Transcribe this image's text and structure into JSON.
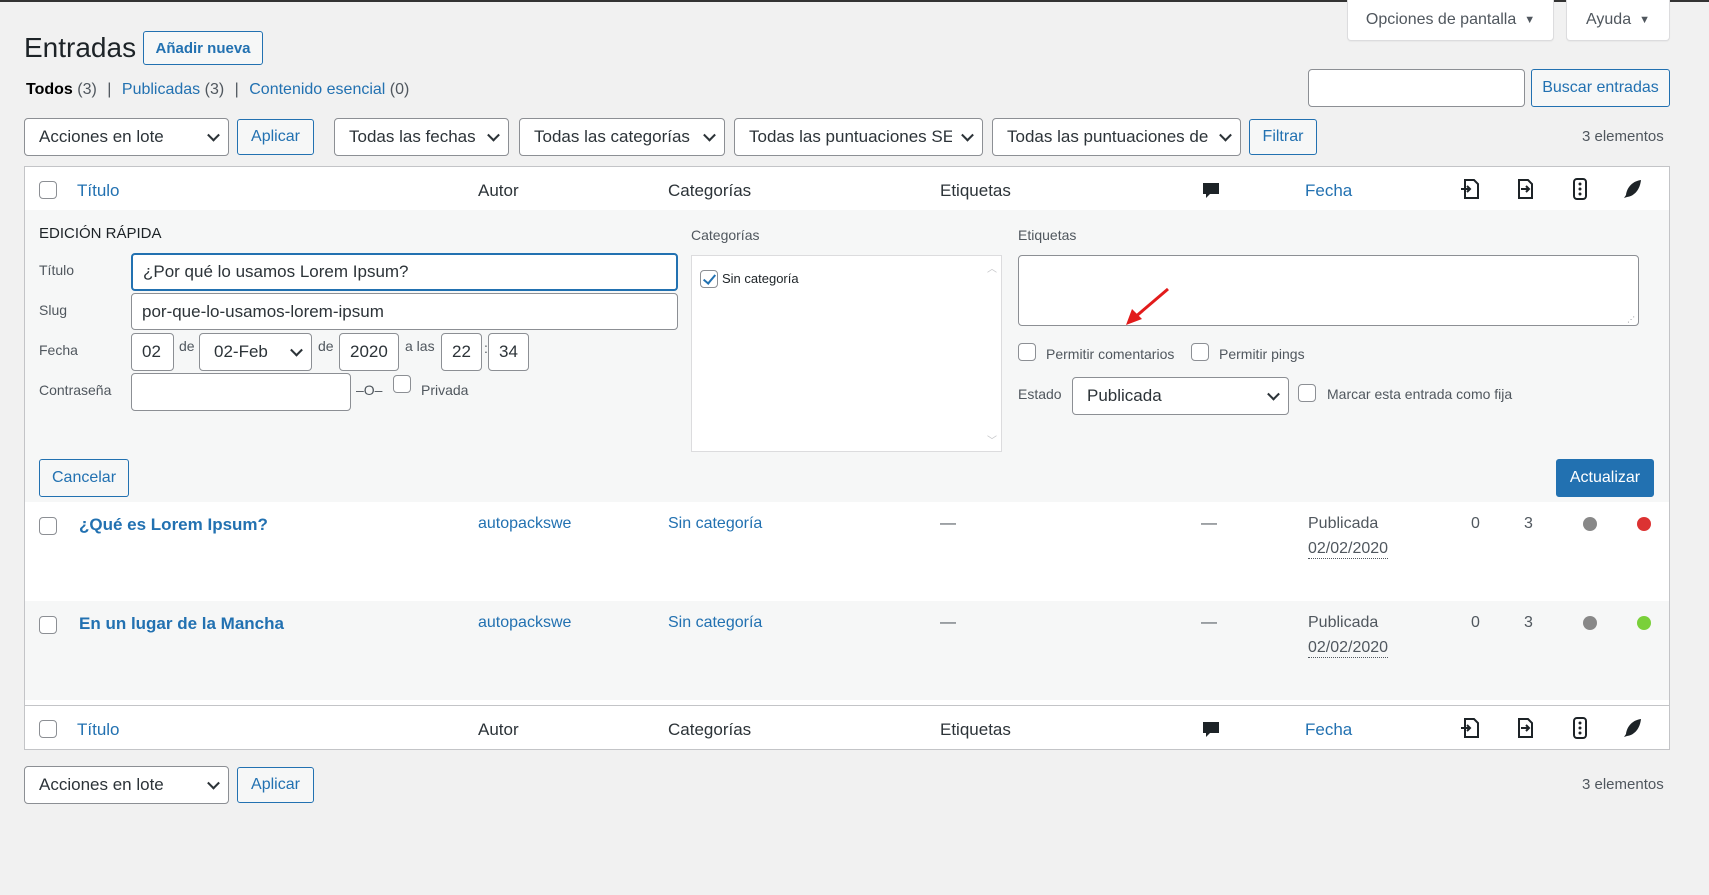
{
  "header": {
    "screen_options_label": "Opciones de pantalla",
    "help_label": "Ayuda",
    "page_title": "Entradas",
    "add_new_label": "Añadir nueva"
  },
  "filters": {
    "all_label": "Todos",
    "all_count": "(3)",
    "published_label": "Publicadas",
    "published_count": "(3)",
    "cornerstone_label": "Contenido esencial",
    "cornerstone_count": "(0)",
    "separator": "|"
  },
  "search": {
    "value": "",
    "button_label": "Buscar entradas"
  },
  "toolbar_top": {
    "bulk_action": "Acciones en lote",
    "apply_label": "Aplicar",
    "dates_filter": "Todas las fechas",
    "categories_filter": "Todas las categorías",
    "seo_filter": "Todas las puntuaciones SEO",
    "readability_filter": "Todas las puntuaciones de",
    "filter_label": "Filtrar",
    "items_count": "3 elementos"
  },
  "columns": {
    "title": "Título",
    "author": "Autor",
    "categories": "Categorías",
    "tags": "Etiquetas",
    "date": "Fecha",
    "comments_icon": "comment-bubble-icon",
    "outgoing_links_icon": "outgoing-links-icon",
    "incoming_links_icon": "incoming-links-icon",
    "seo_score_icon": "seo-score-icon",
    "readability_icon": "readability-feather-icon"
  },
  "quick_edit": {
    "heading": "Edición rápida",
    "title_label": "Título",
    "title_value": "¿Por qué lo usamos Lorem Ipsum?",
    "slug_label": "Slug",
    "slug_value": "por-que-lo-usamos-lorem-ipsum",
    "date_label": "Fecha",
    "day_value": "02",
    "de1": "de",
    "month_value": "02-Feb",
    "de2": "de",
    "year_value": "2020",
    "at_label": "a las",
    "hour_value": "22",
    "colon": ":",
    "minute_value": "34",
    "password_label": "Contraseña",
    "password_value": "",
    "or_label": "–O–",
    "private_label": "Privada",
    "categories_label": "Categorías",
    "uncategorized_label": "Sin categoría",
    "tags_label": "Etiquetas",
    "allow_comments_label": "Permitir comentarios",
    "allow_pings_label": "Permitir pings",
    "status_label": "Estado",
    "status_value": "Publicada",
    "sticky_label": "Marcar esta entrada como fija",
    "cancel_label": "Cancelar",
    "update_label": "Actualizar"
  },
  "rows": [
    {
      "title": "¿Qué es Lorem Ipsum?",
      "author": "autopackswe",
      "category": "Sin categoría",
      "tags": "—",
      "comments": "—",
      "status": "Publicada",
      "date": "02/02/2020",
      "outgoing": "0",
      "incoming": "3",
      "seo_color": "#888888",
      "readability_color": "#dc3232"
    },
    {
      "title": "En un lugar de la Mancha",
      "author": "autopackswe",
      "category": "Sin categoría",
      "tags": "—",
      "comments": "—",
      "status": "Publicada",
      "date": "02/02/2020",
      "outgoing": "0",
      "incoming": "3",
      "seo_color": "#888888",
      "readability_color": "#7ad03a"
    }
  ],
  "toolbar_bottom": {
    "bulk_action": "Acciones en lote",
    "apply_label": "Aplicar",
    "items_count": "3 elementos"
  }
}
